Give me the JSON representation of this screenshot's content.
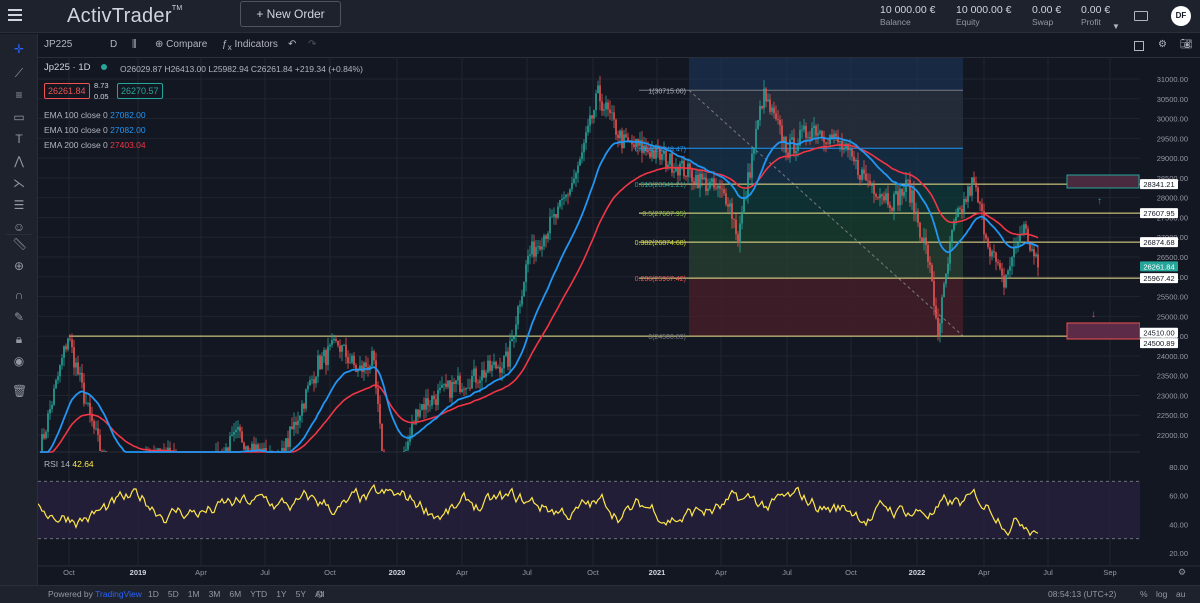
{
  "header": {
    "logo": "ActivTrader",
    "logo_tm": "TM",
    "new_order_label": "New Order",
    "balance_value": "10 000.00 €",
    "balance_label": "Balance",
    "equity_value": "10 000.00 €",
    "equity_label": "Equity",
    "swap_value": "0.00 €",
    "swap_label": "Swap",
    "profit_value": "0.00 €",
    "profit_label": "Profit",
    "avatar": "DF"
  },
  "chart_toolbar": {
    "symbol": "JP225",
    "interval": "D",
    "compare_label": "Compare",
    "indicators_label": "Indicators"
  },
  "legend": {
    "symbol": "Jp225 · 1D",
    "ohlc": "O26029.87 H26413.00 L25982.94 C26261.84 +219.34 (+0.84%)",
    "bid": "26261.84",
    "spread_top": "8.73",
    "spread_bottom": "0.05",
    "ask": "26270.57",
    "ema1_label": "EMA 100 close 0",
    "ema1_value": "27082.00",
    "ema2_label": "EMA 100 close 0",
    "ema2_value": "27082.00",
    "ema3_label": "EMA 200 close 0",
    "ema3_value": "27403.04"
  },
  "rsi": {
    "label": "RSI 14",
    "value": "42.64"
  },
  "colors": {
    "background": "#131722",
    "panel": "#1e222d",
    "up": "#26a69a",
    "down": "#ef5350",
    "ema_blue": "#2196f3",
    "ema_red": "#f23645",
    "fib_line": "#f0e68c",
    "rsi_line": "#ffe74a",
    "last_price": "#26a69a"
  },
  "fib": [
    {
      "label": "1(30715.00)",
      "level": 30715.0
    },
    {
      "label": "0.764(29248.47)",
      "level": 29248.47
    },
    {
      "label": "0.618(28341.21)",
      "level": 28341.21
    },
    {
      "label": "0.5(27607.95)",
      "level": 27607.95
    },
    {
      "label": "0.382(26874.68)",
      "level": 26874.68
    },
    {
      "label": "0.236(25967.42)",
      "level": 25967.42
    },
    {
      "label": "0(24500.89)",
      "level": 24500.89
    }
  ],
  "price_tags": [
    {
      "text": "28341.21",
      "value": 28341.21,
      "kind": "line"
    },
    {
      "text": "27607.95",
      "value": 27607.95,
      "kind": "line"
    },
    {
      "text": "26874.68",
      "value": 26874.68,
      "kind": "line"
    },
    {
      "text": "26261.84",
      "value": 26261.84,
      "kind": "last"
    },
    {
      "text": "25967.42",
      "value": 25967.42,
      "kind": "line"
    },
    {
      "text": "24510.00",
      "value": 24510.0,
      "kind": "line"
    },
    {
      "text": "24500.89",
      "value": 24500.89,
      "kind": "line"
    }
  ],
  "price_axis": [
    "31000.00",
    "30500.00",
    "30000.00",
    "29500.00",
    "29000.00",
    "28500.00",
    "28000.00",
    "27500.00",
    "27000.00",
    "26500.00",
    "26000.00",
    "25500.00",
    "25000.00",
    "24500.00",
    "24000.00",
    "23500.00",
    "23000.00",
    "22500.00",
    "22000.00"
  ],
  "rsi_axis": [
    "80.00",
    "60.00",
    "40.00",
    "20.00"
  ],
  "time_axis": [
    "Oct",
    "2019",
    "Apr",
    "Jul",
    "Oct",
    "2020",
    "Apr",
    "Jul",
    "Oct",
    "2021",
    "Apr",
    "Jul",
    "Oct",
    "2022",
    "Apr",
    "Jul",
    "Sep"
  ],
  "bottom": {
    "powered": "Powered by",
    "brand": "TradingView",
    "ranges": [
      "1D",
      "5D",
      "1M",
      "3M",
      "6M",
      "YTD",
      "1Y",
      "5Y",
      "All"
    ],
    "clock": "08:54:13 (UTC+2)",
    "pct": "%",
    "log": "log",
    "auto": "au"
  }
}
